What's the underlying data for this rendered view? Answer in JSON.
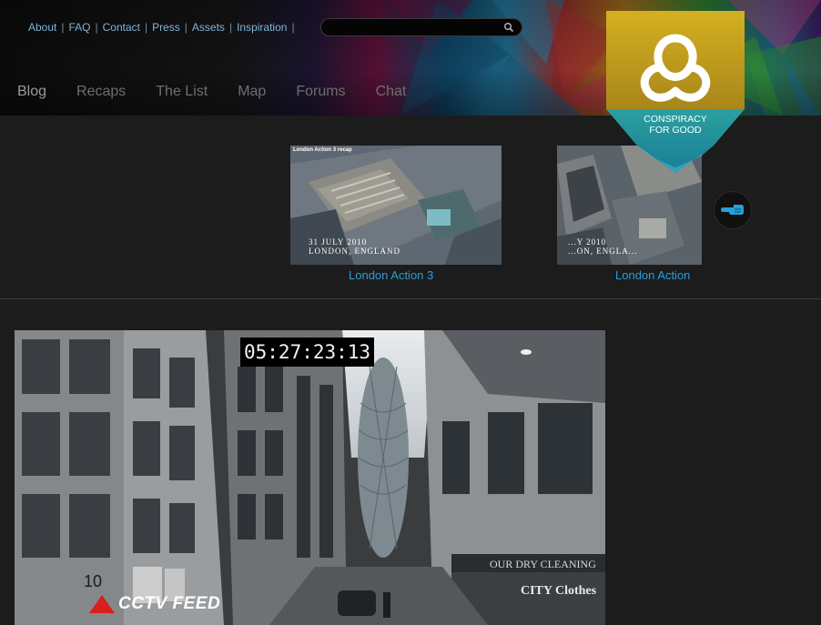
{
  "top_links": [
    "About",
    "FAQ",
    "Contact",
    "Press",
    "Assets",
    "Inspiration"
  ],
  "search": {
    "placeholder": "",
    "value": ""
  },
  "main_nav": [
    "Blog",
    "Recaps",
    "The List",
    "Map",
    "Forums",
    "Chat"
  ],
  "badge": {
    "line1": "CONSPIRACY",
    "line2": "FOR GOOD"
  },
  "videos": [
    {
      "caption": "London Action 3",
      "thumb_title": "London Action 3 recap",
      "overlay_line1": "31 JULY 2010",
      "overlay_line2": "LONDON, ENGLAND"
    },
    {
      "caption": "London Action",
      "overlay_line1": "...Y 2010",
      "overlay_line2": "...ON, ENGLA..."
    }
  ],
  "cctv": {
    "timestamp": "05:27:23:13",
    "label": "CCTV FEED",
    "building_number": "10",
    "storefront_sign": "OUR DRY CLEANING",
    "store_name": "CITY Clothes"
  },
  "icons": {
    "search": "search-icon",
    "next": "pointing-hand-icon",
    "logo": "trefoil-knot-icon",
    "warning": "warning-triangle-icon"
  },
  "colors": {
    "link_blue": "#2a9fd8",
    "top_link": "#7fb4d8",
    "badge_gold": "#c8a21a",
    "badge_teal": "#2a9a9a",
    "cctv_red": "#d8201e"
  }
}
